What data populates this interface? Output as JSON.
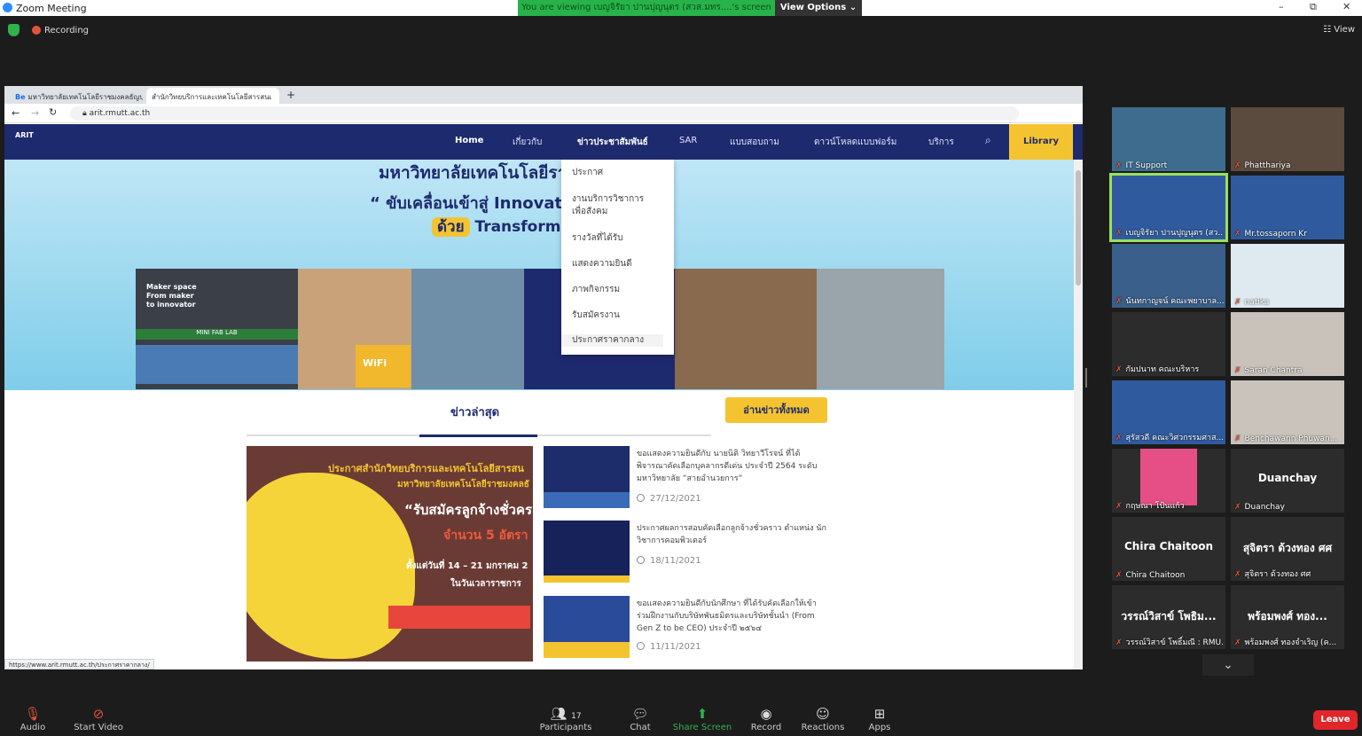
{
  "window": {
    "title": "Zoom Meeting",
    "viewing_banner": "You are viewing เบญจิรัยา ปานปุญนุตร (สวส.มทร....'s screen",
    "view_options": "View Options ⌄",
    "minimize": "–",
    "restore": "⧉",
    "close": "✕"
  },
  "meeting": {
    "recording_label": "Recording",
    "view_label": "☷ View"
  },
  "browser": {
    "tabs": [
      {
        "label": "มหาวิทยาลัยเทคโนโลยีราชมงคลธัญบุรี"
      },
      {
        "label": "สำนักวิทยบริการและเทคโนโลยีสารสนเ"
      }
    ],
    "url": "arit.rmutt.ac.th",
    "status_url": "https://www.arit.rmutt.ac.th/ประกาศราคากลาง/"
  },
  "site": {
    "logo": "ARIT",
    "nav": [
      "Home",
      "เกี่ยวกับ",
      "ข่าวประชาสัมพันธ์",
      "SAR",
      "แบบสอบถาม",
      "ดาวน์โหลดแบบฟอร์ม",
      "บริการ"
    ],
    "library": "Library",
    "hero": {
      "line1": "มหาวิทยาลัยเทคโนโลยีรา",
      "line2": "“ ขับเคลื่อนเข้าสู่ Innovat",
      "line3_tag": "ด้วย",
      "line3": "Transform"
    },
    "collage": {
      "maker_space": "Maker space\nFrom maker\nto innovator",
      "fab_lab": "MINI FAB LAB",
      "wifi": "WiFi"
    },
    "dropdown": [
      "ประกาศ",
      "งานบริการวิชาการ\nเพื่อสังคม",
      "รางวัลที่ได้รับ",
      "แสดงความยินดี",
      "ภาพกิจกรรม",
      "รับสมัครงาน",
      "ประกาศราคากลาง"
    ],
    "news_heading": "ข่าวล่าสุด",
    "read_all": "อ่านข่าวทั้งหมด",
    "poster": {
      "l1": "ประกาศสำนักวิทยบริการและเทคโนโลยีสารสน",
      "l2": "มหาวิทยาลัยเทคโนโลยีราชมงคลธั",
      "l3": "“รับสมัครลูกจ้างชั่วคร",
      "l4": "จำนวน 5 อัตรา",
      "l5": "ตั้งแต่วันที่ 14 – 21 มกราคม 2",
      "l6": "ในวันเวลาราชการ"
    },
    "news": [
      {
        "title": "ขอแสดงความยินดีกับ นายนิติ วิทยาวีโรจน์ ที่ได้พิจารณาคัดเลือกบุคลากรดีเด่น ประจำปี 2564 ระดับมหาวิทยาลัย “สายอำนวยการ”",
        "date": "27/12/2021"
      },
      {
        "title": "ประกาศผลการสอบคัดเลือกลูกจ้างชั่วคราว ตำแหน่ง นักวิชาการคอมพิวเตอร์",
        "date": "18/11/2021"
      },
      {
        "title": "ขอแสดงความยินดีกับนักศึกษา ที่ได้รับคัดเลือกให้เข้าร่วมฝึกงานกับบริษัทพันธมิตรและบริษัทชั้นนำ (From Gen Z to be CEO) ประจำปี ๒๕๖๔",
        "date": "11/11/2021"
      }
    ]
  },
  "participants": [
    {
      "name": "IT Support",
      "big": ""
    },
    {
      "name": "Phatthariya",
      "big": ""
    },
    {
      "name": "เบญจิรัยา ปานปุญนุตร (สว...",
      "big": ""
    },
    {
      "name": "Mr.tossaporn Kr",
      "big": ""
    },
    {
      "name": "นันทกาญจน์ คณะพยาบาล...",
      "big": ""
    },
    {
      "name": "natika",
      "big": ""
    },
    {
      "name": "กัมปนาท คณะบริหาร",
      "big": ""
    },
    {
      "name": "Saran Chantra",
      "big": ""
    },
    {
      "name": "สุรัสวดี คณะวิศวกรรมศาส...",
      "big": ""
    },
    {
      "name": "Benchawann Phuwan...",
      "big": ""
    },
    {
      "name": "กฤษณา โป้นแก้ว",
      "big": ""
    },
    {
      "name": "Duanchay",
      "big": "Duanchay"
    },
    {
      "name": "Chira Chaitoon",
      "big": "Chira Chaitoon"
    },
    {
      "name": "สุจิตรา ด้วงทอง ศศ",
      "big": "สุจิตรา ด้วงทอง ศศ"
    },
    {
      "name": "วรรณ์วิสาข์ โพธิ์มณี : RMU...",
      "big": "วรรณ์วิสาข์ โพธิม..."
    },
    {
      "name": "พร้อมพงศ์ ทองจำเริญ (ค...",
      "big": "พร้อมพงศ์ ทอง..."
    }
  ],
  "toolbar": {
    "audio": "Audio",
    "video": "Start Video",
    "participants": "Participants",
    "participants_count": "17",
    "chat": "Chat",
    "share": "Share Screen",
    "record": "Record",
    "reactions": "Reactions",
    "apps": "Apps",
    "leave": "Leave"
  },
  "colors": {
    "navy": "#1e2a6e",
    "accent_yellow": "#f4c430",
    "zoom_green": "#2fb24c",
    "leave_red": "#e0252b"
  }
}
